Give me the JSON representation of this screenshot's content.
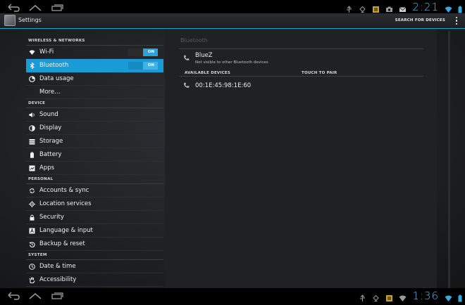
{
  "status_bar": {
    "time": "2:21",
    "icons": [
      "usb-icon",
      "android-debug-icon",
      "notification-app-icon",
      "camera-icon",
      "mail-icon",
      "keyboard-icon",
      "wifi-icon",
      "battery-icon"
    ]
  },
  "action_bar": {
    "title": "Settings",
    "search_button": "SEARCH FOR DEVICES"
  },
  "sidebar": {
    "sections": [
      {
        "label": "WIRELESS & NETWORKS"
      },
      {
        "label": "DEVICE"
      },
      {
        "label": "PERSONAL"
      },
      {
        "label": "SYSTEM"
      }
    ],
    "items": [
      {
        "label": "Wi-Fi",
        "icon": "wifi-icon",
        "toggle": "ON"
      },
      {
        "label": "Bluetooth",
        "icon": "bluetooth-icon",
        "toggle": "ON"
      },
      {
        "label": "Data usage",
        "icon": "data-usage-icon"
      },
      {
        "label": "More…"
      },
      {
        "label": "Sound",
        "icon": "sound-icon"
      },
      {
        "label": "Display",
        "icon": "display-icon"
      },
      {
        "label": "Storage",
        "icon": "storage-icon"
      },
      {
        "label": "Battery",
        "icon": "battery-icon"
      },
      {
        "label": "Apps",
        "icon": "apps-icon"
      },
      {
        "label": "Accounts & sync",
        "icon": "sync-icon"
      },
      {
        "label": "Location services",
        "icon": "location-icon"
      },
      {
        "label": "Security",
        "icon": "lock-icon"
      },
      {
        "label": "Language & input",
        "icon": "language-icon"
      },
      {
        "label": "Backup & reset",
        "icon": "backup-icon"
      },
      {
        "label": "Date & time",
        "icon": "clock-icon"
      },
      {
        "label": "Accessibility",
        "icon": "accessibility-icon"
      }
    ]
  },
  "detail": {
    "title": "Bluetooth",
    "this_device": {
      "name": "BlueZ",
      "subtitle": "Not visible to other Bluetooth devices"
    },
    "available_header": "AVAILABLE DEVICES",
    "touch_header": "TOUCH TO PAIR",
    "devices": [
      {
        "name": "00:1E:45:98:1E:60"
      }
    ]
  },
  "nav_bar": {
    "time": "1:36"
  },
  "colors": {
    "accent": "#1a9ad6",
    "clock": "#5db6e6"
  }
}
